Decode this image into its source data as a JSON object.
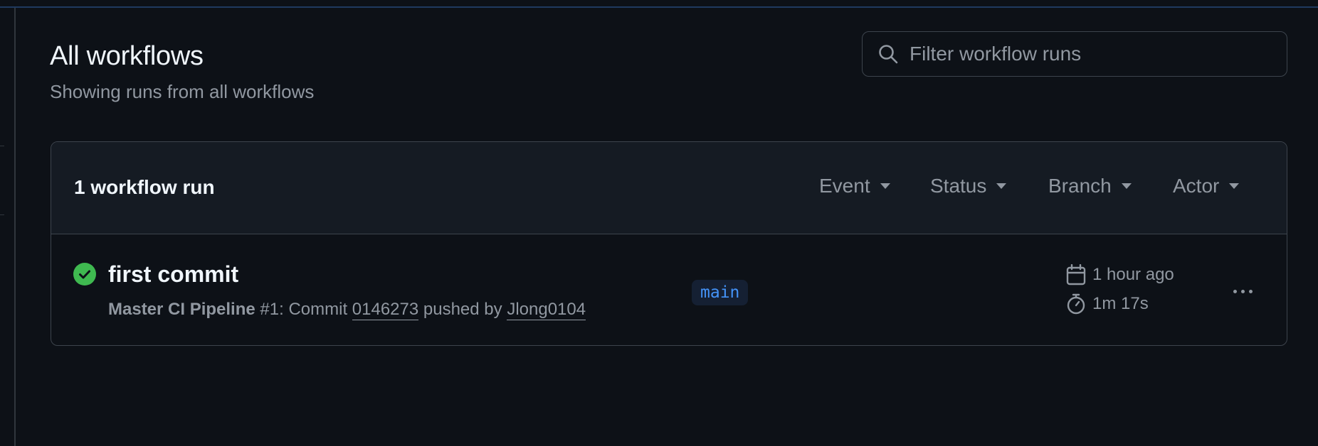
{
  "page": {
    "title": "All workflows",
    "subtitle": "Showing runs from all workflows"
  },
  "search": {
    "placeholder": "Filter workflow runs",
    "value": ""
  },
  "runs_panel": {
    "count_label": "1 workflow run",
    "filters": [
      "Event",
      "Status",
      "Branch",
      "Actor"
    ]
  },
  "runs": [
    {
      "title": "first commit",
      "status": "success",
      "status_icon": "check-circle-icon",
      "workflow_name": "Master CI Pipeline",
      "run_number": "#1",
      "meta_prefix": ": Commit ",
      "commit": "0146273",
      "pushed_by_label": " pushed by ",
      "actor": "Jlong0104",
      "branch": "main",
      "time_ago": "1 hour ago",
      "duration": "1m 17s"
    }
  ],
  "colors": {
    "background": "#0d1117",
    "header_background": "#151b23",
    "border": "#3d444d",
    "success": "#3fb950",
    "accent": "#4493f8",
    "muted_text": "#9198a1"
  }
}
